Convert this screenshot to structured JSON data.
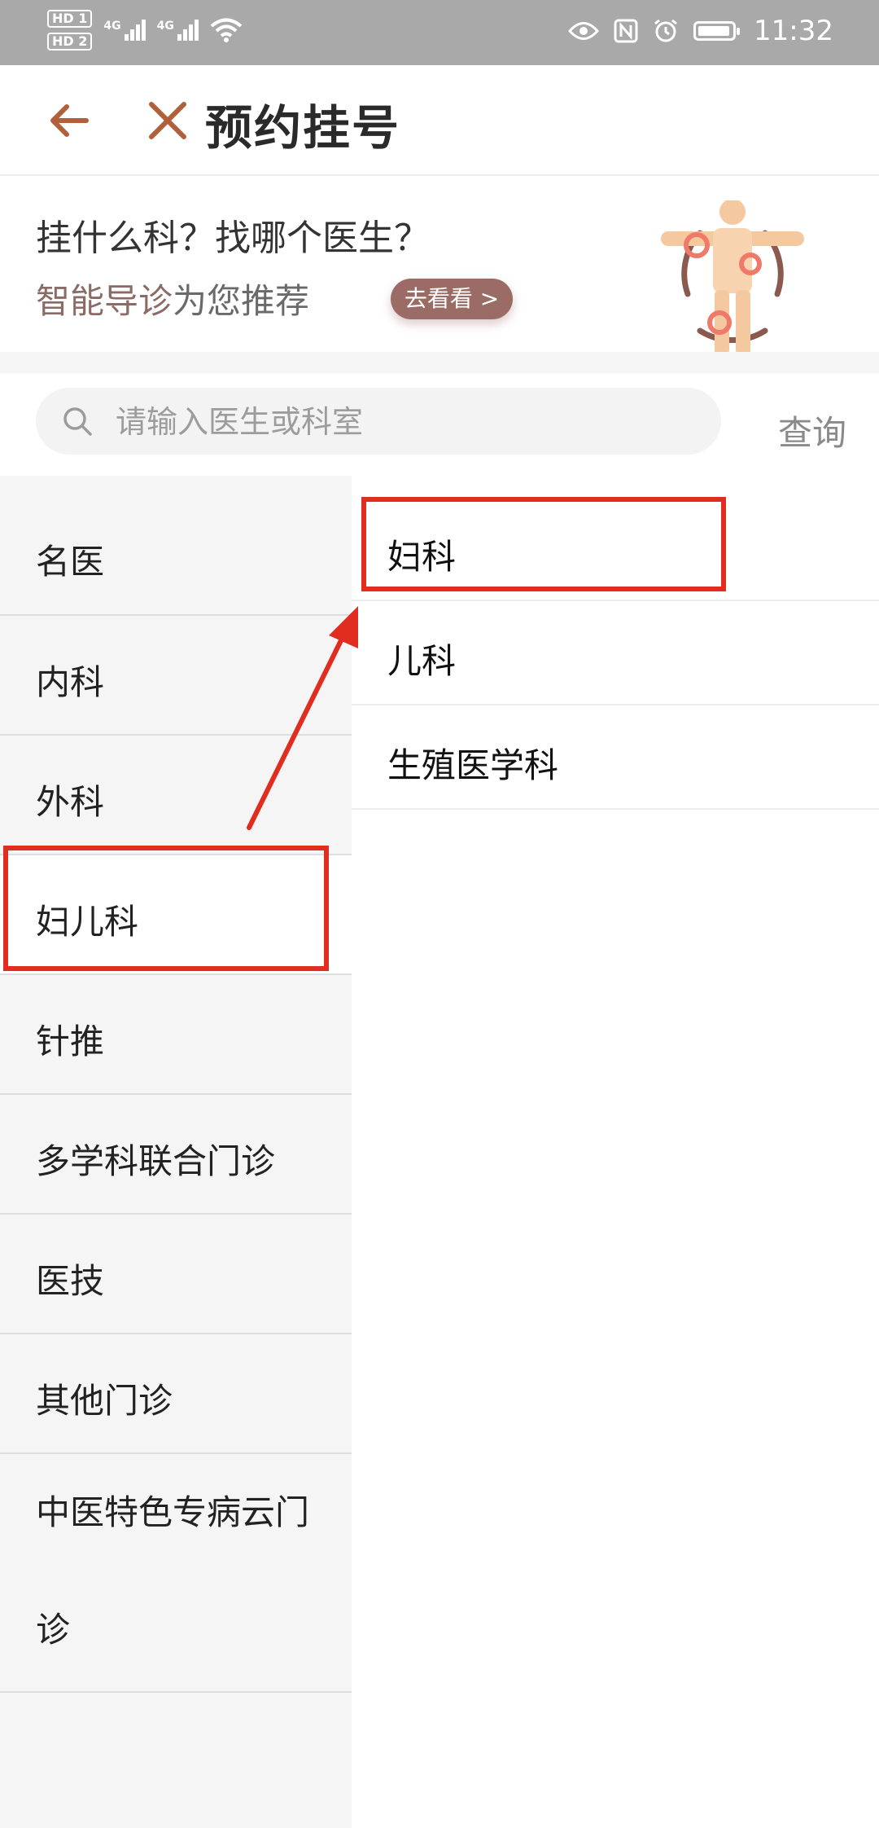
{
  "status_bar": {
    "hd1": "HD 1",
    "hd2": "HD 2",
    "net1": "4G",
    "net2": "4G",
    "time": "11:32"
  },
  "nav": {
    "title": "预约挂号",
    "back_icon": "arrow-left-icon",
    "close_icon": "close-icon"
  },
  "banner": {
    "question": "挂什么科？找哪个医生？",
    "sub_highlight": "智能导诊",
    "sub_rest": "为您推荐",
    "button": "去看看 >"
  },
  "search": {
    "placeholder": "请输入医生或科室",
    "button": "查询"
  },
  "categories": [
    {
      "label": "名医"
    },
    {
      "label": "内科"
    },
    {
      "label": "外科"
    },
    {
      "label": "妇儿科"
    },
    {
      "label": "针推"
    },
    {
      "label": "多学科联合门诊"
    },
    {
      "label": "医技"
    },
    {
      "label": "其他门诊"
    },
    {
      "label": "中医特色专病云门诊"
    }
  ],
  "selected_category": "妇儿科",
  "subdepartments": [
    {
      "label": "妇科"
    },
    {
      "label": "儿科"
    },
    {
      "label": "生殖医学科"
    }
  ],
  "colors": {
    "accent": "#b0603a",
    "banner_brown": "#8b6b65",
    "annotation_red": "#e12c20"
  }
}
